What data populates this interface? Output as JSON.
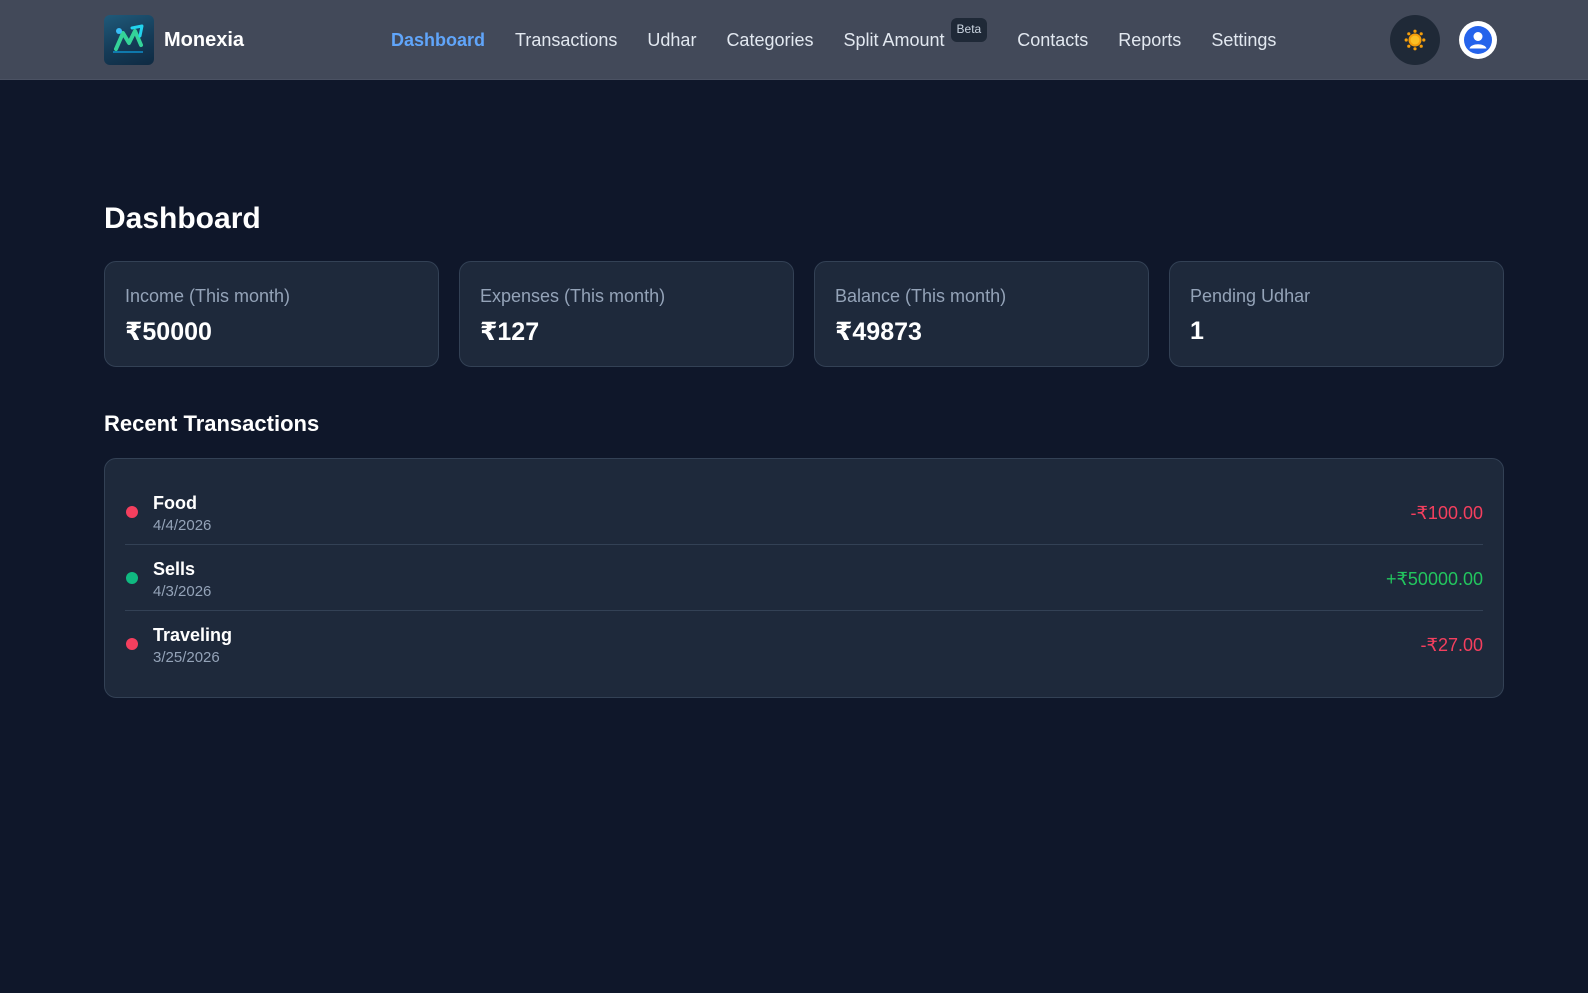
{
  "brand": {
    "name": "Monexia"
  },
  "nav": {
    "items": [
      {
        "label": "Dashboard",
        "active": true
      },
      {
        "label": "Transactions"
      },
      {
        "label": "Udhar"
      },
      {
        "label": "Categories"
      },
      {
        "label": "Split Amount",
        "badge": "Beta"
      },
      {
        "label": "Contacts"
      },
      {
        "label": "Reports"
      },
      {
        "label": "Settings"
      }
    ],
    "theme_icon": "sun-icon",
    "profile_icon": "user-avatar-icon"
  },
  "main": {
    "title": "Dashboard",
    "stats": [
      {
        "label": "Income (This month)",
        "value": "₹50000"
      },
      {
        "label": "Expenses (This month)",
        "value": "₹127"
      },
      {
        "label": "Balance (This month)",
        "value": "₹49873"
      },
      {
        "label": "Pending Udhar",
        "value": "1"
      }
    ],
    "recent_title": "Recent Transactions",
    "transactions": [
      {
        "name": "Food",
        "date": "4/4/2026",
        "amount": "-₹100.00",
        "type": "expense"
      },
      {
        "name": "Sells",
        "date": "4/3/2026",
        "amount": "+₹50000.00",
        "type": "income"
      },
      {
        "name": "Traveling",
        "date": "3/25/2026",
        "amount": "-₹27.00",
        "type": "expense"
      }
    ]
  },
  "colors": {
    "background": "#0f172a",
    "navbar": "#424959",
    "card": "#1e293b",
    "accent": "#60a5fa",
    "income": "#22c55e",
    "expense": "#f43f5e",
    "sun": "#f59e0b",
    "avatar": "#2563eb"
  }
}
